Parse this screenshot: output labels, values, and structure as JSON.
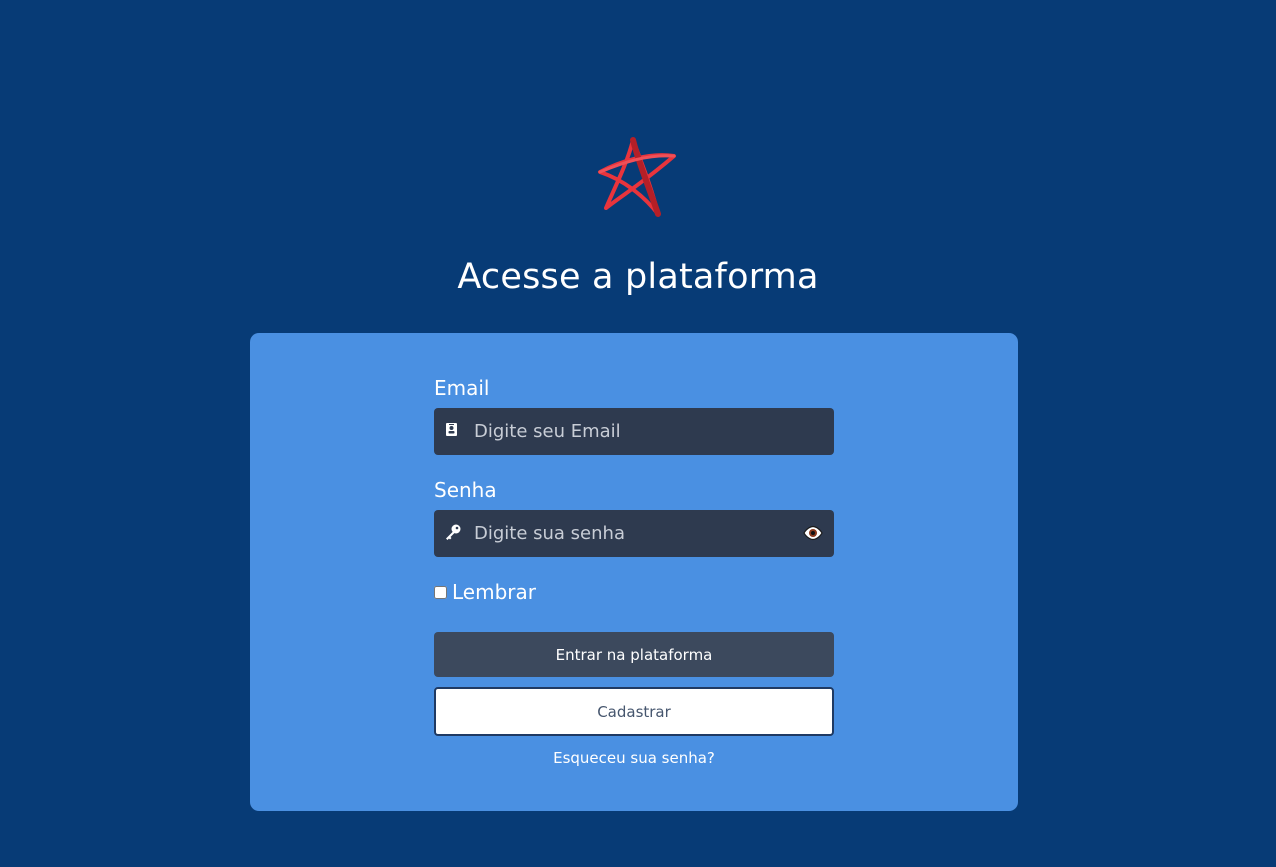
{
  "colors": {
    "page_background": "#073b76",
    "card_background": "#4a90e2",
    "input_background": "#2e3a4f",
    "primary_button": "#3c495d",
    "logo_red": "#e8343c"
  },
  "logo": {
    "icon": "star-logo-icon"
  },
  "page": {
    "title": "Acesse a plataforma"
  },
  "form": {
    "email": {
      "label": "Email",
      "placeholder": "Digite seu Email",
      "value": "",
      "icon": "contact-card-icon"
    },
    "password": {
      "label": "Senha",
      "placeholder": "Digite sua senha",
      "value": "",
      "icon": "key-icon",
      "toggle_icon": "eye-icon"
    },
    "remember": {
      "label": "Lembrar",
      "checked": false
    },
    "submit_label": "Entrar na plataforma",
    "register_label": "Cadastrar",
    "forgot_label": "Esqueceu sua senha?"
  }
}
